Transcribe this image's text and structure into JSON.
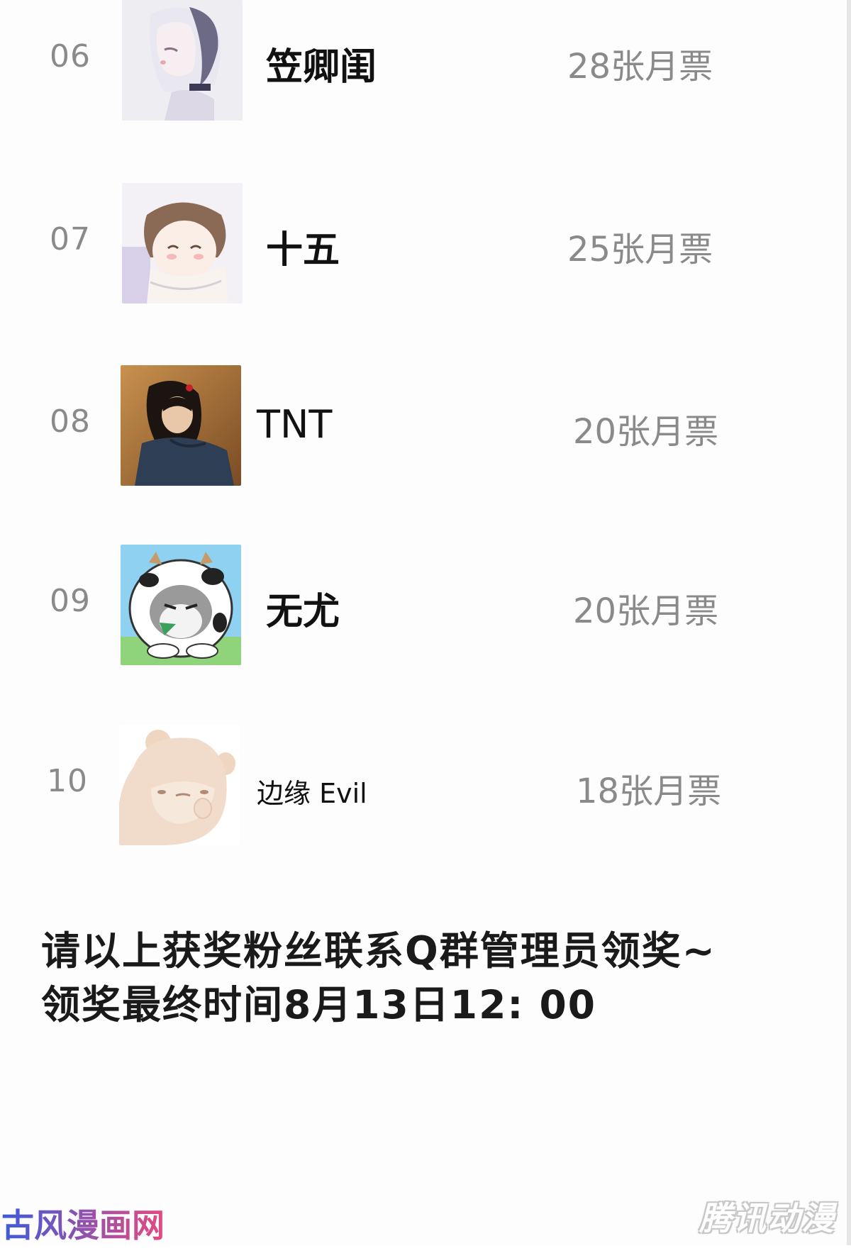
{
  "ranking": [
    {
      "rank": "06",
      "name": "笠卿闺",
      "votes": "28张月票",
      "avatar": "anime-girl-white-hair-avatar"
    },
    {
      "rank": "07",
      "name": "十五",
      "votes": "25张月票",
      "avatar": "anime-girl-scarf-avatar"
    },
    {
      "rank": "08",
      "name": "TNT",
      "votes": "20张月票",
      "avatar": "girl-photo-avatar"
    },
    {
      "rank": "09",
      "name": "无尤",
      "votes": "20张月票",
      "avatar": "cat-cow-costume-avatar"
    },
    {
      "rank": "10",
      "name": "边缘 Evil",
      "votes": "18张月票",
      "avatar": "bear-avatar"
    }
  ],
  "notice": {
    "line1": "请以上获奖粉丝联系Q群管理员领奖~",
    "line2": "领奖最终时间8月13日12: 00"
  },
  "watermarks": {
    "left": "古风漫画网",
    "right": "腾讯动漫"
  },
  "colors": {
    "rank_text": "#8a8a8a",
    "name_text": "#111111",
    "notice_text": "#1a1a1a",
    "watermark_left_start": "#3b5bdb",
    "watermark_left_end": "#e64980"
  }
}
